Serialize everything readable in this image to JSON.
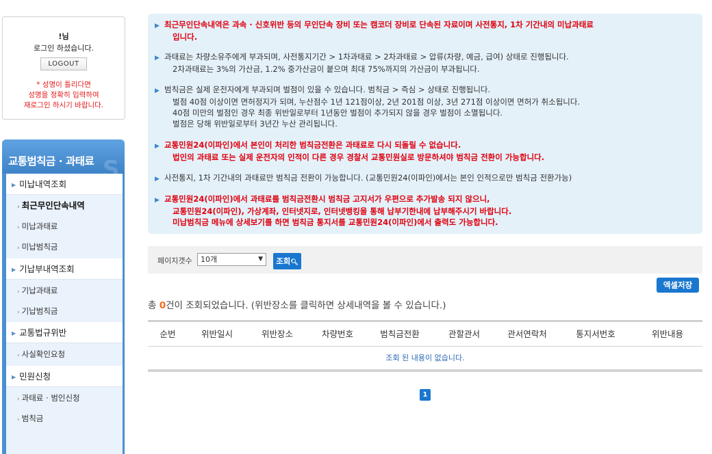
{
  "login": {
    "user": "!님",
    "greeting": "로그인 하셨습니다.",
    "logout_label": "LOGOUT",
    "warning_lines": [
      "* 성명이 틀리다면",
      "성명을 정확히 입력하여",
      "재로그인 하시기 바랍니다."
    ]
  },
  "sidebar": {
    "title": "교통범칙금 · 과태료",
    "items": [
      {
        "label": "미납내역조회",
        "type": "main"
      },
      {
        "label": "최근무인단속내역",
        "type": "sub",
        "active": true
      },
      {
        "label": "미납과태료",
        "type": "sub"
      },
      {
        "label": "미납범칙금",
        "type": "sub"
      },
      {
        "label": "기납부내역조회",
        "type": "main"
      },
      {
        "label": "기납과태료",
        "type": "sub"
      },
      {
        "label": "기납범칙금",
        "type": "sub"
      },
      {
        "label": "교통법규위반",
        "type": "main"
      },
      {
        "label": "사실확인요청",
        "type": "sub"
      },
      {
        "label": "민원신청",
        "type": "main"
      },
      {
        "label": "과태료 · 범인신청",
        "type": "sub"
      },
      {
        "label": "범칙금",
        "type": "sub"
      }
    ]
  },
  "info": [
    {
      "red": true,
      "lines": [
        "최근무인단속내역은 과속 · 신호위반 등의 무인단속 장비 또는 캠코더 장비로 단속된 자료이며 사전통지, 1차 기간내의 미납과태료",
        "입니다."
      ]
    },
    {
      "red": false,
      "lines": [
        "과태료는 차량소유주에게 부과되며, 사전통지기간 > 1차과태료 > 2차과태료 > 압류(차량, 예금, 급여) 상태로 진행됩니다.",
        "2차과태료는 3%의 가산금, 1.2% 중가산금이 붙으며 최대 75%까지의 가산금이 부과됩니다."
      ]
    },
    {
      "red": false,
      "lines": [
        "범칙금은 실제 운전자에게 부과되며 벌점이 있을 수 있습니다. 범칙금 > 즉심 > 상태로 진행됩니다.",
        "벌점 40점 이상이면 면허정지가 되며, 누산점수 1년 121점이상, 2년 201점 이상, 3년 271점 이상이면 면허가 취소됩니다.",
        "40점 미만의 벌점인 경우 최종 위반일로부터 1년동안 벌점이 추가되지 않을 경우 벌점이 소멸됩니다.",
        "벌점은 당해 위반일로부터 3년간 누산 관리됩니다."
      ]
    },
    {
      "red": true,
      "lines": [
        "교통민원24(이파인)에서 본인이 처리한 범칙금전환은 과태료로 다시 되돌릴 수 없습니다.",
        "법인의 과태료 또는 실제 운전자의 인적이 다른 경우 경찰서 교통민원실로 방문하셔야 범칙금 전환이 가능합니다."
      ]
    },
    {
      "red": false,
      "lines": [
        "사전통지, 1차 기간내의 과태료만 범칙금 전환이 가능합니다. (교통민원24(이파인)에서는 본인 인적으로만 범칙금 전환가능)"
      ]
    },
    {
      "red": true,
      "lines": [
        "교통민원24(이파인)에서 과태료를 범칙금전환시 범칙금 고지서가 우편으로 추가발송 되지 않으니,",
        "교통민원24(이파인), 가상계좌, 인터넷지로, 인터넷뱅킹을 통해 납부기한내에 납부해주시기 바랍니다.",
        "미납범칙금 메뉴에 상세보기를 하면 범칙금 통지서를 교통민원24(이파인)에서 출력도 가능합니다."
      ]
    }
  ],
  "controls": {
    "page_count_label": "페이지갯수",
    "page_count_value": "10개",
    "search_label": "조회",
    "excel_label": "엑셀저장"
  },
  "result": {
    "prefix": "총 ",
    "count": "0",
    "suffix": "건이 조회되었습니다. (위반장소를 클릭하면 상세내역을 볼 수 있습니다.)"
  },
  "table": {
    "columns": [
      "순번",
      "위반일시",
      "위반장소",
      "차량번호",
      "범칙금전환",
      "관할관서",
      "관서연락처",
      "통지서번호",
      "위반내용"
    ],
    "empty_message": "조회 된 내용이 없습니다."
  },
  "pagination": {
    "current": "1"
  }
}
